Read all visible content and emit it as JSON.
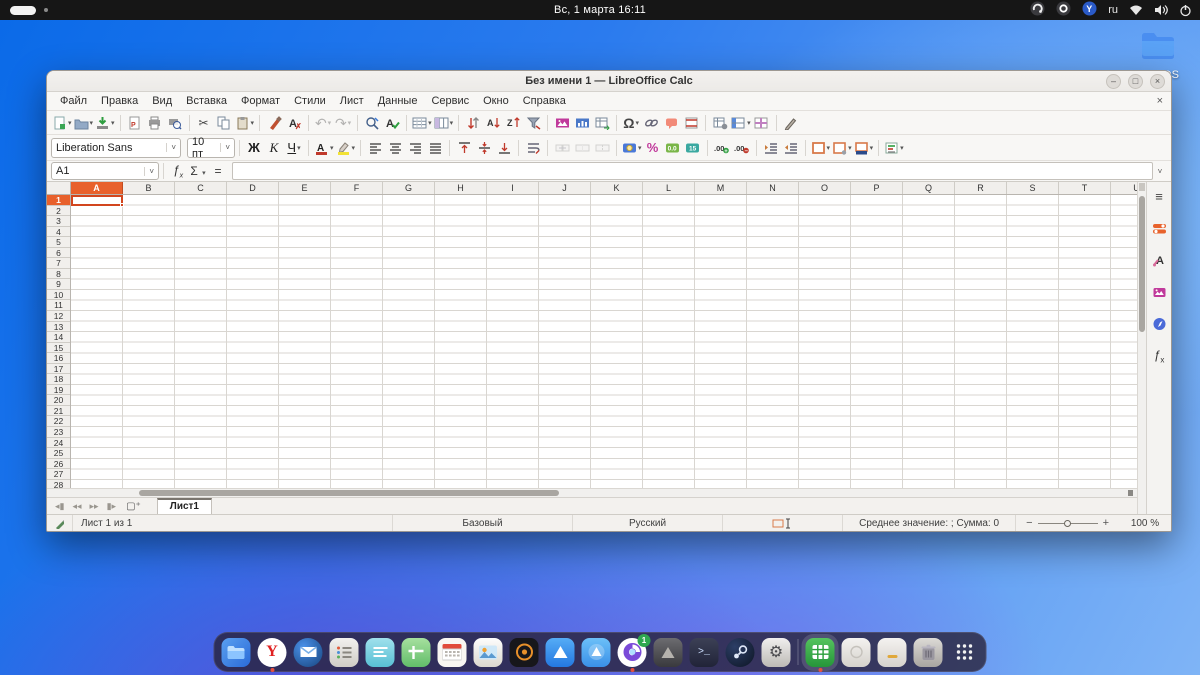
{
  "colors": {
    "accent_orange": "#e8612c",
    "selection_border": "#d2461e",
    "header_bg": "#f1efec",
    "topbar_bg": "#161616",
    "calc_green": "#2a9e3a"
  },
  "topbar": {
    "clock": "Вс, 1 марта  16:11",
    "keyboard_layout": "ru",
    "tray": [
      {
        "name": "recorder-indicator-icon"
      },
      {
        "name": "app-indicator-icon"
      },
      {
        "name": "yandex-indicator-icon",
        "letter": "Y"
      }
    ]
  },
  "desktop": {
    "folder_label": "OS"
  },
  "window": {
    "title": "Без имени 1 — LibreOffice Calc",
    "controls": {
      "minimize": "–",
      "maximize": "□",
      "close": "×"
    },
    "doc_close": "×",
    "menus": [
      "Файл",
      "Правка",
      "Вид",
      "Вставка",
      "Формат",
      "Стили",
      "Лист",
      "Данные",
      "Сервис",
      "Окно",
      "Справка"
    ],
    "toolbar_standard": [
      {
        "name": "new-button",
        "kind": "new",
        "dd": true
      },
      {
        "name": "open-button",
        "kind": "folder",
        "dd": true
      },
      {
        "name": "save-button",
        "kind": "save",
        "dd": true
      },
      {
        "sep": true
      },
      {
        "name": "export-pdf-button",
        "kind": "pdf"
      },
      {
        "name": "print-button",
        "kind": "print"
      },
      {
        "name": "print-preview-button",
        "kind": "printprev"
      },
      {
        "sep": true
      },
      {
        "name": "cut-button",
        "kind": "cut"
      },
      {
        "name": "copy-button",
        "kind": "copy"
      },
      {
        "name": "paste-button",
        "kind": "paste",
        "dd": true
      },
      {
        "sep": true
      },
      {
        "name": "clone-formatting-button",
        "kind": "clone"
      },
      {
        "name": "clear-formatting-button",
        "kind": "clearfmt"
      },
      {
        "sep": true
      },
      {
        "name": "undo-button",
        "kind": "undo",
        "dd": true,
        "dis": true
      },
      {
        "name": "redo-button",
        "kind": "redo",
        "dd": true,
        "dis": true
      },
      {
        "sep": true
      },
      {
        "name": "find-replace-button",
        "kind": "find"
      },
      {
        "name": "spelling-button",
        "kind": "spell"
      },
      {
        "sep": true
      },
      {
        "name": "insert-row-button",
        "kind": "rows",
        "dd": true
      },
      {
        "name": "insert-column-button",
        "kind": "cols",
        "dd": true
      },
      {
        "sep": true
      },
      {
        "name": "sort-button",
        "kind": "sort"
      },
      {
        "name": "sort-ascending-button",
        "kind": "sortaz"
      },
      {
        "name": "sort-descending-button",
        "kind": "sortza"
      },
      {
        "name": "autofilter-button",
        "kind": "filter"
      },
      {
        "sep": true
      },
      {
        "name": "insert-image-button",
        "kind": "image"
      },
      {
        "name": "insert-chart-button",
        "kind": "chart"
      },
      {
        "name": "pivot-table-button",
        "kind": "pivot"
      },
      {
        "sep": true
      },
      {
        "name": "special-character-button",
        "kind": "omega",
        "dd": true
      },
      {
        "name": "hyperlink-button",
        "kind": "link"
      },
      {
        "name": "comment-button",
        "kind": "comment"
      },
      {
        "name": "headers-footers-button",
        "kind": "hf"
      },
      {
        "sep": true
      },
      {
        "name": "freeze-panes-button",
        "kind": "freezegear"
      },
      {
        "name": "freeze-rows-columns-button",
        "kind": "freeze",
        "dd": true
      },
      {
        "name": "split-window-button",
        "kind": "split"
      },
      {
        "sep": true
      },
      {
        "name": "show-draw-functions-button",
        "kind": "pencil"
      }
    ],
    "toolbar_formatting": {
      "font_name": "Liberation Sans",
      "font_size": "10 пт",
      "buttons": [
        {
          "name": "bold-button",
          "kind": "bold"
        },
        {
          "name": "italic-button",
          "kind": "italic"
        },
        {
          "name": "underline-button",
          "kind": "underline",
          "dd": true
        },
        {
          "sep": true
        },
        {
          "name": "font-color-button",
          "kind": "fontcolor",
          "dd": true
        },
        {
          "name": "highlight-color-button",
          "kind": "highlight",
          "dd": true
        },
        {
          "sep": true
        },
        {
          "name": "align-left-button",
          "kind": "alignl"
        },
        {
          "name": "align-center-button",
          "kind": "alignc"
        },
        {
          "name": "align-right-button",
          "kind": "alignr"
        },
        {
          "name": "align-justified-button",
          "kind": "alignj"
        },
        {
          "sep": true
        },
        {
          "name": "align-top-button",
          "kind": "vtop"
        },
        {
          "name": "center-vertically-button",
          "kind": "vcenter"
        },
        {
          "name": "align-bottom-button",
          "kind": "vbottom"
        },
        {
          "sep": true
        },
        {
          "name": "wrap-text-button",
          "kind": "wrap"
        },
        {
          "sep": true
        },
        {
          "name": "merge-center-cells-button",
          "kind": "merge1",
          "dis": true
        },
        {
          "name": "merge-cells-button",
          "kind": "merge2",
          "dis": true
        },
        {
          "name": "unmerge-cells-button",
          "kind": "merge3",
          "dis": true
        },
        {
          "sep": true
        },
        {
          "name": "currency-format-button",
          "kind": "currency",
          "dd": true
        },
        {
          "name": "percent-format-button",
          "kind": "percent"
        },
        {
          "name": "number-format-button",
          "kind": "numfmt"
        },
        {
          "name": "date-format-button",
          "kind": "datefmt"
        },
        {
          "sep": true
        },
        {
          "name": "add-decimal-button",
          "kind": "adddec"
        },
        {
          "name": "delete-decimal-button",
          "kind": "deldec"
        },
        {
          "sep": true
        },
        {
          "name": "increase-indent-button",
          "kind": "indentinc"
        },
        {
          "name": "decrease-indent-button",
          "kind": "indentdec"
        },
        {
          "sep": true
        },
        {
          "name": "borders-button",
          "kind": "borders",
          "dd": true
        },
        {
          "name": "border-style-button",
          "kind": "borderstyle",
          "dd": true
        },
        {
          "name": "background-color-button",
          "kind": "bgcolor",
          "dd": true
        },
        {
          "sep": true
        },
        {
          "name": "conditional-formatting-button",
          "kind": "condfmt",
          "dd": true
        }
      ]
    },
    "formula_bar": {
      "cell_reference": "A1",
      "function_wizard": "ƒx",
      "sum": "Σ",
      "equals": "=",
      "input_value": ""
    },
    "sidebar_icons": [
      {
        "name": "sidebar-settings-icon",
        "kind": "hamb"
      },
      {
        "name": "properties-deck-icon",
        "kind": "props"
      },
      {
        "name": "styles-deck-icon",
        "kind": "styles"
      },
      {
        "name": "gallery-deck-icon",
        "kind": "gallery"
      },
      {
        "name": "navigator-deck-icon",
        "kind": "navig"
      },
      {
        "name": "functions-deck-icon",
        "kind": "fx"
      }
    ],
    "grid": {
      "columns": [
        "A",
        "B",
        "C",
        "D",
        "E",
        "F",
        "G",
        "H",
        "I",
        "J",
        "K",
        "L",
        "M",
        "N",
        "O",
        "P",
        "Q",
        "R",
        "S",
        "T",
        "U"
      ],
      "selected_column": "A",
      "row_count": 28,
      "selected_row": 1
    },
    "sheet_nav": [
      "first",
      "previous",
      "next",
      "last"
    ],
    "sheet_tabs": [
      "Лист1"
    ],
    "statusbar": {
      "sheet_info": "Лист 1 из 1",
      "page_style": "Базовый",
      "language": "Русский",
      "stats": "Среднее значение: ; Сумма: 0",
      "zoom_minus": "−",
      "zoom_plus": "+",
      "zoom_level": "100 %"
    }
  },
  "dock": {
    "items": [
      {
        "name": "files-app",
        "kind": "folder",
        "bg": "linear-gradient(135deg,#5aa0f0,#2a6ad8)"
      },
      {
        "name": "yandex-browser-app",
        "kind": "ybrowser",
        "bg": "#ffffff",
        "circle": true,
        "dot": true
      },
      {
        "name": "thunderbird-app",
        "kind": "thunderbird",
        "bg": "radial-gradient(circle at 35% 30%,#4a90e8,#17457e)",
        "circle": true
      },
      {
        "name": "tasks-app",
        "kind": "tasklist",
        "bg": "linear-gradient(#f2f1ef,#cfccc6)"
      },
      {
        "name": "text-editor-app",
        "kind": "textlines",
        "bg": "linear-gradient(#9fe0ec,#58bfd4)"
      },
      {
        "name": "planner-app",
        "kind": "plustable",
        "bg": "linear-gradient(#a6e09e,#62bd6a)"
      },
      {
        "name": "calendar-app",
        "kind": "calendar",
        "bg": "#f8f6f2"
      },
      {
        "name": "photos-app",
        "kind": "photo",
        "bg": "linear-gradient(#fdfdfd,#dcd8ce)"
      },
      {
        "name": "music-app",
        "kind": "speaker",
        "bg": "#17171b"
      },
      {
        "name": "drive-app",
        "kind": "triangle",
        "bg": "linear-gradient(#55acf6,#2478e0)"
      },
      {
        "name": "app-center-app",
        "kind": "tricircle",
        "bg": "linear-gradient(#6cc0f8,#3a90e8)"
      },
      {
        "name": "browser-profile-app",
        "kind": "swirl",
        "bg": "#ffffff",
        "circle": true,
        "badge": "1",
        "dot": true
      },
      {
        "name": "dark-utility-app",
        "kind": "tridark",
        "bg": "linear-gradient(#6c6c70,#39393d)"
      },
      {
        "name": "terminal-app",
        "kind": "terminal",
        "bg": "linear-gradient(#3c4156,#212438)"
      },
      {
        "name": "steam-app",
        "kind": "steam",
        "bg": "radial-gradient(circle at 32% 30%,#2c3e66,#0d1524)",
        "circle": true
      },
      {
        "name": "settings-app",
        "kind": "gear",
        "bg": "linear-gradient(#f0efee,#bdbab5)"
      },
      {
        "sep": true
      },
      {
        "name": "libreoffice-calc-app",
        "kind": "calc",
        "bg": "linear-gradient(#55c45e,#26953a)",
        "dot": true,
        "active": true
      },
      {
        "name": "light-app-1",
        "kind": "blankcircle",
        "bg": "linear-gradient(#f4f2f0,#d5d2cc)"
      },
      {
        "name": "light-app-2",
        "kind": "blankmark",
        "bg": "linear-gradient(#f4f2f0,#d5d2cc)"
      },
      {
        "name": "trash-app",
        "kind": "trash",
        "bg": "linear-gradient(#dcdad6,#a8a5a0)"
      },
      {
        "name": "show-apps-button",
        "kind": "dots",
        "bg": "transparent"
      }
    ]
  }
}
